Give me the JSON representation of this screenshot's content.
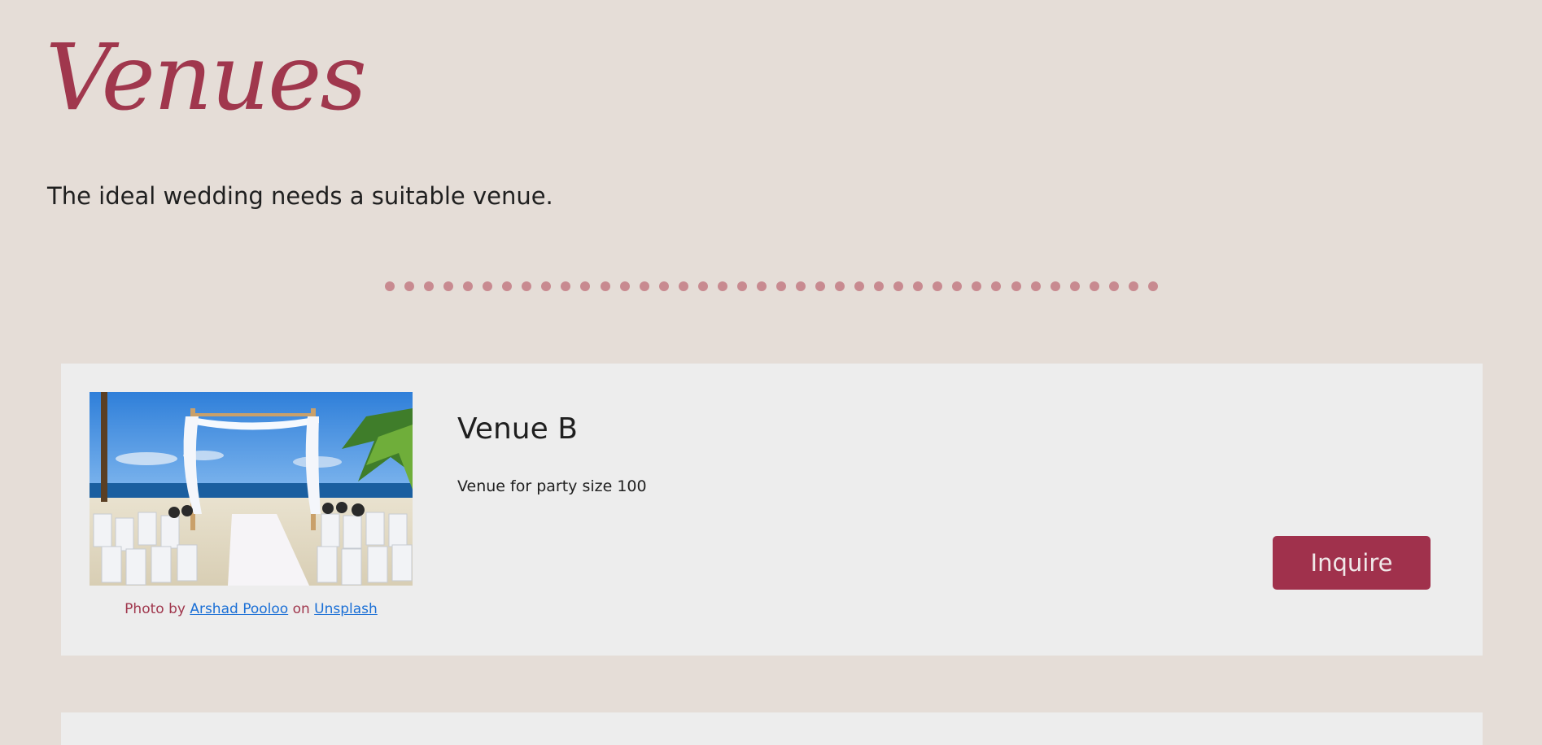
{
  "page": {
    "title": "Venues",
    "subtitle": "The ideal wedding needs a suitable venue."
  },
  "colors": {
    "background": "#e5ddd7",
    "accent": "#a0374d",
    "divider_dot": "#c88a90",
    "card_background": "#ededed",
    "link": "#1a6fd6"
  },
  "venues": [
    {
      "name": "Venue B",
      "description": "Venue for party size 100",
      "photo_alt": "beach wedding ceremony setup with white chairs and arch",
      "credit": {
        "prefix": "Photo by",
        "author": "Arshad Pooloo",
        "middle": "on",
        "source": "Unsplash"
      },
      "button_label": "Inquire"
    }
  ]
}
